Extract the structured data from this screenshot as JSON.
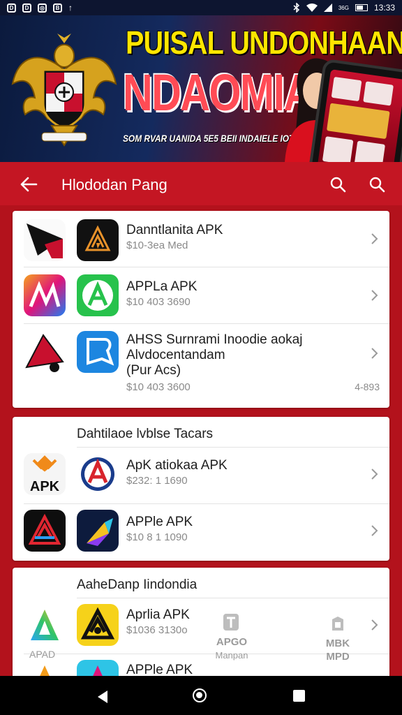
{
  "status_bar": {
    "time": "13:33",
    "network": "36G",
    "left_icons": [
      "D",
      "D",
      "◎",
      "B",
      "↑"
    ]
  },
  "banner": {
    "title_line1": "PUISAL UNDONHAAN",
    "title_line2": "NDAOMIA",
    "subtitle": "SOM RVAR UANIDA 5E5 BEII INDAIELE IOTAS"
  },
  "app_bar": {
    "title": "Hlododan Pang"
  },
  "sections": [
    {
      "title": "",
      "items": [
        {
          "name": "Danntlanita APK",
          "meta": "$10-3ea Med",
          "extra": ""
        },
        {
          "name": "APPLa APK",
          "meta": "$10 403 3690",
          "extra": ""
        },
        {
          "name": "AHSS Surnrami Inoodie aokaj Alvdocentandam (Pur Acs)",
          "name_lines": [
            "AHSS Surnrami Inoodie aokaj",
            "Alvdocentandam",
            "(Pur Acs)"
          ],
          "meta": "$10 403 3600",
          "extra": "4-893"
        }
      ]
    },
    {
      "title": "Dahtilaoe lvblse Tacars",
      "items": [
        {
          "name": "ApK atiokaa APK",
          "meta": "$232: 1 1690",
          "extra": ""
        },
        {
          "name": "APPle APK",
          "meta": "$10 8 1 1090",
          "extra": ""
        }
      ]
    },
    {
      "title": "AaheDanp Iindondia",
      "items": [
        {
          "name": "Aprlia APK",
          "meta": "$1036 3130o",
          "extra": ""
        },
        {
          "name": "APPle APK",
          "meta": "",
          "extra": ""
        }
      ]
    }
  ],
  "overlay_labels": {
    "left": "APAD",
    "mid_line1": "APGO",
    "mid_line2": "Manpan",
    "right_line1": "MBK",
    "right_line2": "MPD"
  },
  "colors": {
    "accent": "#c41623",
    "background": "#b3121c"
  }
}
